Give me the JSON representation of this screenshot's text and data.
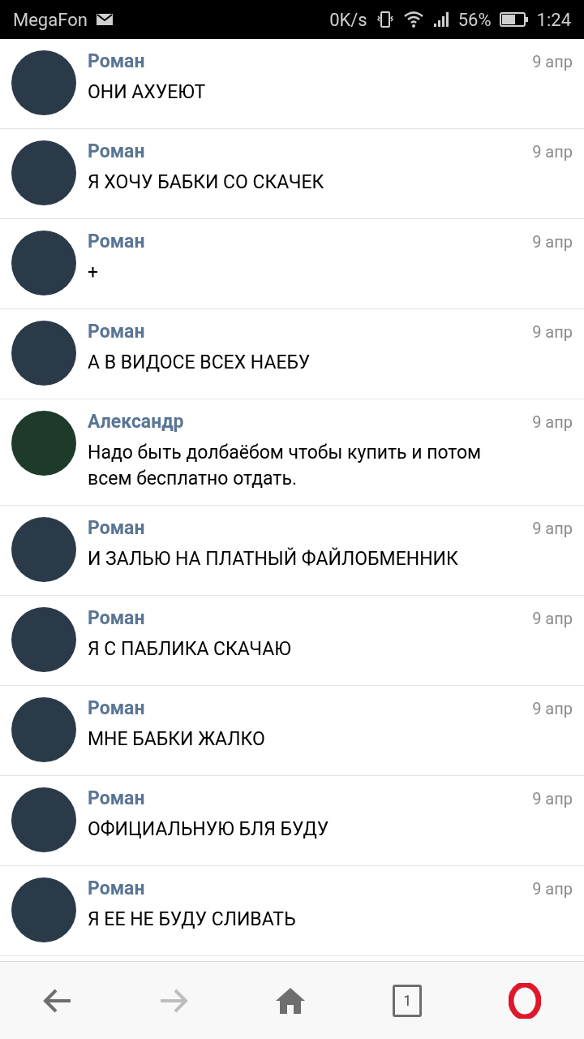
{
  "status_bar": {
    "carrier": "MegaFon",
    "speed": "0K/s",
    "battery": "56%",
    "time": "1:24"
  },
  "messages": [
    {
      "author": "Роман",
      "kind": "dark",
      "date": "9 апр",
      "text": "ОНИ АХУЕЮТ"
    },
    {
      "author": "Роман",
      "kind": "dark",
      "date": "9 апр",
      "text": "Я ХОЧУ БАБКИ СО СКАЧЕК"
    },
    {
      "author": "Роман",
      "kind": "dark",
      "date": "9 апр",
      "text": "+"
    },
    {
      "author": "Роман",
      "kind": "dark",
      "date": "9 апр",
      "text": "А В ВИДОСЕ ВСЕХ НАЕБУ"
    },
    {
      "author": "Александр",
      "kind": "code",
      "date": "9 апр",
      "text": "Надо быть долбаёбом чтобы купить и потом всем бесплатно отдать."
    },
    {
      "author": "Роман",
      "kind": "dark",
      "date": "9 апр",
      "text": "И ЗАЛЬЮ НА ПЛАТНЫЙ ФАЙЛОБМЕННИК"
    },
    {
      "author": "Роман",
      "kind": "dark",
      "date": "9 апр",
      "text": "Я С ПАБЛИКА СКАЧАЮ"
    },
    {
      "author": "Роман",
      "kind": "dark",
      "date": "9 апр",
      "text": "МНЕ БАБКИ ЖАЛКО"
    },
    {
      "author": "Роман",
      "kind": "dark",
      "date": "9 апр",
      "text": "ОФИЦИАЛЬНУЮ БЛЯ БУДУ"
    },
    {
      "author": "Роман",
      "kind": "dark",
      "date": "9 апр",
      "text": "Я ЕЕ НЕ БУДУ СЛИВАТЬ"
    }
  ],
  "bottom_bar": {
    "back_disabled": false,
    "forward_disabled": true,
    "tab_count": "1"
  }
}
